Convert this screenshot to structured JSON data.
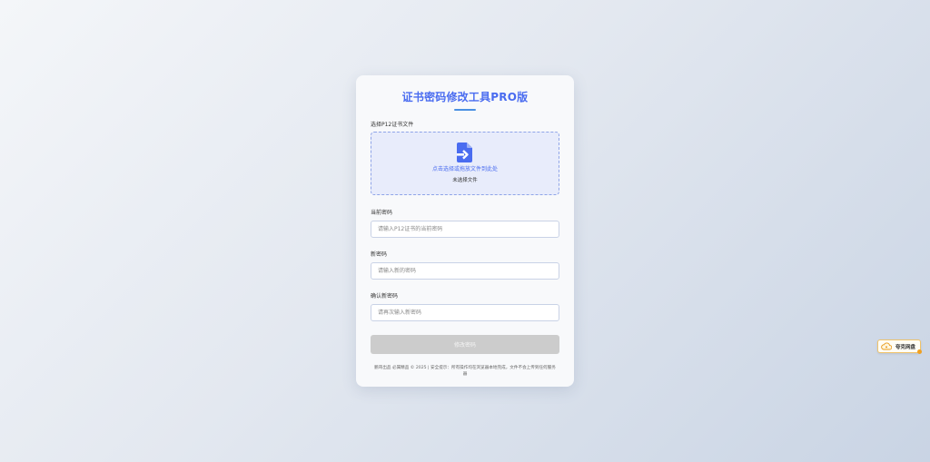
{
  "form": {
    "title": "证书密码修改工具PRO版",
    "file_label": "选择P12证书文件",
    "dropzone_text": "点击选择或拖放文件到此处",
    "file_status": "未选择文件",
    "current_password": {
      "label": "当前密码",
      "placeholder": "请输入P12证书的当前密码",
      "value": ""
    },
    "new_password": {
      "label": "新密码",
      "placeholder": "请输入新的密码",
      "value": ""
    },
    "confirm_password": {
      "label": "确认新密码",
      "placeholder": "请再次输入新密码",
      "value": ""
    },
    "submit_label": "修改密码",
    "footer": "鹏哥出品 必属精品 © 2025 | 安全提示：所有操作均在浏览器本地完成，文件不会上传到任何服务器"
  },
  "side_badge": {
    "label": "夸克网盘",
    "icon": "cloud-icon"
  },
  "colors": {
    "accent": "#4a6cf0",
    "dropzone_bg": "#e8ecfb",
    "button_disabled": "#cccccc",
    "badge_border": "#f0c36a"
  }
}
